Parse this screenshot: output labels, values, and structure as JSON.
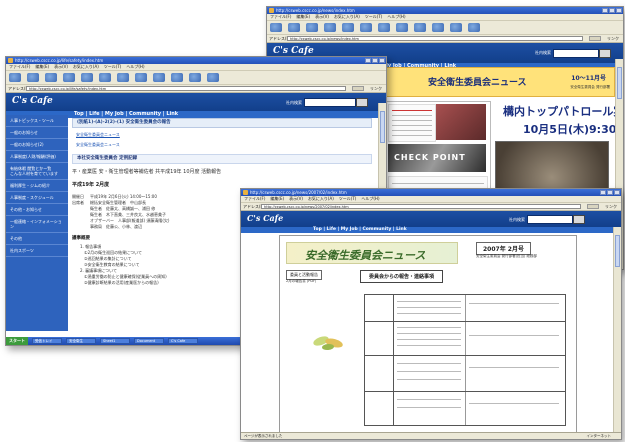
{
  "browser": {
    "title_suffix": "- Microsoft Internet Explorer",
    "menu": [
      "ファイル(F)",
      "編集(E)",
      "表示(V)",
      "お気に入り(A)",
      "ツール(T)",
      "ヘルプ(H)"
    ],
    "address_label": "アドレス(D)",
    "go_label": "移動",
    "links_label": "リンク",
    "status_text": "ページが表示されました",
    "zone_text": "インターネット"
  },
  "site": {
    "logo": "C's Cafe",
    "nav": "Top | Life | My Job | Community | Link",
    "search_label": "社内検索"
  },
  "window_front": {
    "url": "http://csweb.cscc.co.jp/news/2007/02/index.htm",
    "title": "安全衛生委員会ニュース",
    "date": "2007年 2月号",
    "issuer": "安全衛生委員会 発行部署(担当) 総務部",
    "tab_labels": [
      "委員と活動報告",
      "委員会からの報告・連絡事項"
    ],
    "nav_hint": "2月の報告書 (PDF)"
  },
  "window_back": {
    "url": "http://csweb.cscc.co.jp/news/index.htm",
    "banner": "安全衛生委員会ニュース",
    "issue": "10～11月号",
    "headline_line1": "構内トップパトロール実施",
    "headline_line2": "10月5日(木)9:30～",
    "photo_sign": "CHECK POINT",
    "side_caption": "安全衛生委員会 発行部署"
  },
  "window_mid": {
    "url": "http://csweb.cscc.co.jp/life/safety/index.htm",
    "page_title": "(別紙1)-(A)-2(2)-(1) 安全衛生委員会の報告",
    "sub_link": "安全衛生委員会ニュース",
    "record_heading": "本社安全衛生委員会 定例記録",
    "meeting_line": "平・産業医 安・衛生管理者等補佐者 共平成19年 10月度 活動報告",
    "year_line": "平成19年 2月度",
    "rows": [
      {
        "label": "開催日",
        "value": "平成19年 2月6日(火) 14:00～15:00"
      },
      {
        "label": "出席者",
        "value": "総括安全衛生管理者　中山部長"
      },
      {
        "label": "",
        "value": "衛生者　佐藤太、高橋誠一、浦田 修"
      },
      {
        "label": "",
        "value": "衛生者　木下直美、三井良太、水越恵美子"
      },
      {
        "label": "",
        "value": "オブザーバー　人事部(報道部) 須藤清隆(欠)"
      },
      {
        "label": "",
        "value": "事務局　佐藤公、小林、渡辺"
      }
    ],
    "agenda_heading": "議事概要",
    "agenda": [
      "1. 報告事項",
      "　①2月の衛生巡回の結果について",
      "　②巡回結果の集計について",
      "　③安全衛生教育の結果について",
      "2. 審議事項について",
      "　①過重労働の防止と健康確保(従業員への周知)",
      "　②健康診断結果の活用(産業医からの報告)"
    ],
    "sidebar": [
      "人事トピックス・ツール",
      "一般のお知らせ",
      "一般のお知らせ(2)",
      "人事制度(人財/報酬/評価)",
      "有給休暇 閲覧とかー覧\nこんな人材を育てています",
      "福利厚生・ジムの紹介",
      "人事制度・スケジュール",
      "その他・お知らせ",
      "一般連絡・インフォメーション",
      "その他",
      "社内スポーツ"
    ]
  },
  "taskbar": {
    "start": "スタート",
    "buttons": [
      "受信トレイ",
      "安全衛生",
      "Sheet1",
      "Document",
      "C's Cafe"
    ]
  }
}
